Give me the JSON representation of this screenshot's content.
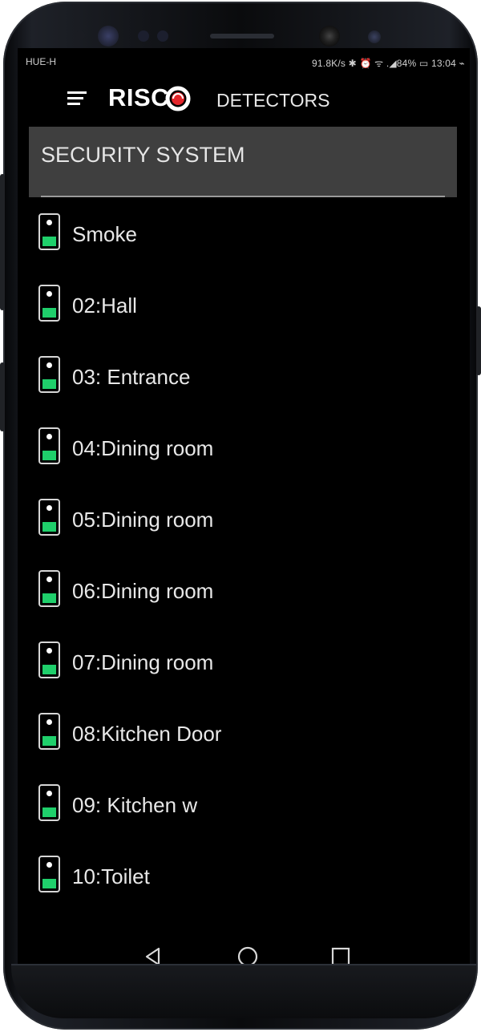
{
  "status_bar": {
    "carrier": "HUE-H",
    "indicators": "91.8K/s ✱ ⏰ ᯤ .◢84% ▭ 13:04 ⌁"
  },
  "app_bar": {
    "logo_text": "RISC",
    "title": "DETECTORS",
    "menu_icon": "hamburger-icon",
    "logo_color": "#e3262b"
  },
  "section": {
    "label": "SECURITY SYSTEM"
  },
  "detectors": [
    {
      "label": "Smoke"
    },
    {
      "label": "02:Hall"
    },
    {
      "label": "03: Entrance"
    },
    {
      "label": "04:Dining room"
    },
    {
      "label": "05:Dining room"
    },
    {
      "label": "06:Dining room"
    },
    {
      "label": "07:Dining room"
    },
    {
      "label": "08:Kitchen Door"
    },
    {
      "label": "09: Kitchen w"
    },
    {
      "label": "10:Toilet"
    }
  ],
  "colors": {
    "status_ok": "#1fcf6b",
    "header_bg": "#3f3f3f",
    "screen_bg": "#000000"
  },
  "nav": {
    "back_icon": "back-triangle-icon",
    "home_icon": "home-circle-icon",
    "recents_icon": "recents-square-icon"
  }
}
